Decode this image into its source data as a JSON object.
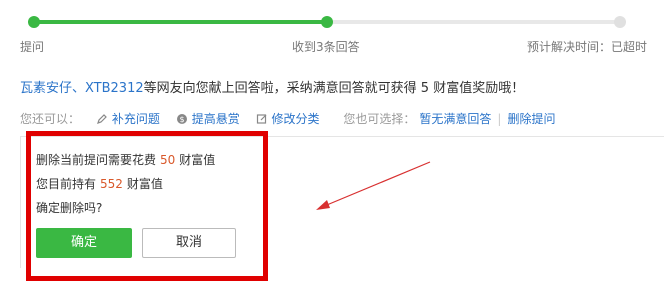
{
  "progress": {
    "steps": [
      {
        "label": "提问"
      },
      {
        "label": "收到3条回答"
      },
      {
        "label": "预计解决时间：已超时"
      }
    ]
  },
  "notice": {
    "users": "瓦素安仔、XTB2312",
    "text": "等网友向您献上回答啦，采纳满意回答就可获得",
    "reward_num": "5",
    "tail": "财富值奖励哦！"
  },
  "actions": {
    "prefix": "您还可以：",
    "items": [
      "补充问题",
      "提高悬赏",
      "修改分类"
    ],
    "also_prefix": "您也可选择：",
    "also_items": [
      "暂无满意回答",
      "删除提问"
    ]
  },
  "dialog": {
    "line1_pre": "删除当前提问需要花费",
    "cost": "50",
    "line1_post": "财富值",
    "line2_pre": "您目前持有",
    "balance": "552",
    "line2_post": "财富值",
    "line3": "确定删除吗?",
    "ok_label": "确定",
    "cancel_label": "取消"
  },
  "colors": {
    "accent": "#3ab843",
    "link": "#2b74c9",
    "highlight": "#d9592b",
    "annotation": "#e00000"
  }
}
